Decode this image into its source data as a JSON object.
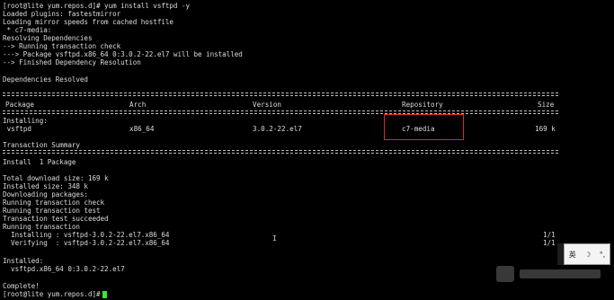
{
  "terminal": {
    "lines": {
      "l01": "[root@lite yum.repos.d]# yum install vsftpd -y",
      "l02": "Loaded plugins: fastestmirror",
      "l03": "Loading mirror speeds from cached hostfile",
      "l04": " * c7-media:",
      "l05": "Resolving Dependencies",
      "l06": "--> Running transaction check",
      "l07": "---> Package vsftpd.x86_64 0:3.0.2-22.el7 will be installed",
      "l08": "--> Finished Dependency Resolution",
      "l09": "Dependencies Resolved",
      "l10": "Installing:",
      "l11": "Transaction Summary",
      "l12": "Install  1 Package",
      "l13": "Total download size: 169 k",
      "l14": "Installed size: 348 k",
      "l15": "Downloading packages:",
      "l16": "Running transaction check",
      "l17": "Running transaction test",
      "l18": "Transaction test succeeded",
      "l19": "Running transaction",
      "l20": "  Installing : vsftpd-3.0.2-22.el7.x86_64",
      "l21": "  Verifying  : vsftpd-3.0.2-22.el7.x86_64",
      "l22": "Installed:",
      "l23": "  vsftpd.x86_64 0:3.0.2-22.el7",
      "l24": "Complete!",
      "l25": "[root@lite yum.repos.d]# "
    },
    "progress": {
      "installing": "1/1",
      "verifying": "1/1"
    },
    "table": {
      "headers": {
        "package": "Package",
        "arch": "Arch",
        "version": "Version",
        "repository": "Repository",
        "size": "Size"
      },
      "row": {
        "package": " vsftpd",
        "arch": "x86_64",
        "version": "3.0.2-22.el7",
        "repository": "c7-media",
        "size": "169 k"
      }
    }
  },
  "ime": {
    "lang": "英",
    "moon": "☽",
    "punct": "°,"
  },
  "colors": {
    "background": "#000000",
    "text": "#dcdcdc",
    "highlight_border": "#d62a2a",
    "cursor": "#35e835"
  }
}
